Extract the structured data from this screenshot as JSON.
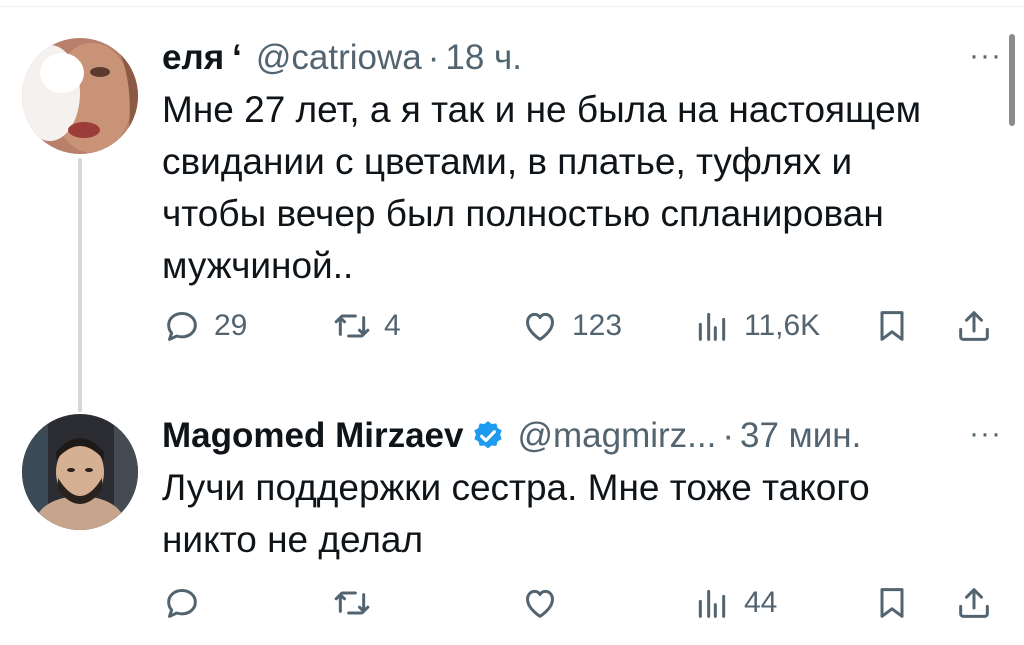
{
  "tweets": [
    {
      "author": "еля",
      "author_suffix": "‘",
      "handle": "@catriowa",
      "separator": "·",
      "time": "18 ч.",
      "text_lines": [
        "Мне 27 лет, а я так и не была на настоящем",
        "свидании с цветами, в платье, туфлях и",
        "чтобы вечер был полностью спланирован",
        "мужчиной.."
      ],
      "replies": "29",
      "retweets": "4",
      "likes": "123",
      "views": "11,6K",
      "more": "···"
    },
    {
      "author": "Magomed Mirzaev",
      "verified": true,
      "handle": "@magmirz...",
      "separator": "·",
      "time": "37 мин.",
      "text_lines": [
        "Лучи поддержки сестра. Мне тоже такого",
        "никто не делал"
      ],
      "replies": "",
      "retweets": "",
      "likes": "",
      "views": "44",
      "more": "···"
    }
  ],
  "icons": [
    "reply-icon",
    "retweet-icon",
    "like-icon",
    "views-icon",
    "bookmark-icon",
    "share-icon",
    "verified-icon",
    "more-icon"
  ],
  "colors": {
    "text": "#0f1419",
    "muted": "#536471",
    "verified": "#1d9bf0",
    "thread_line": "#cfd9de"
  }
}
